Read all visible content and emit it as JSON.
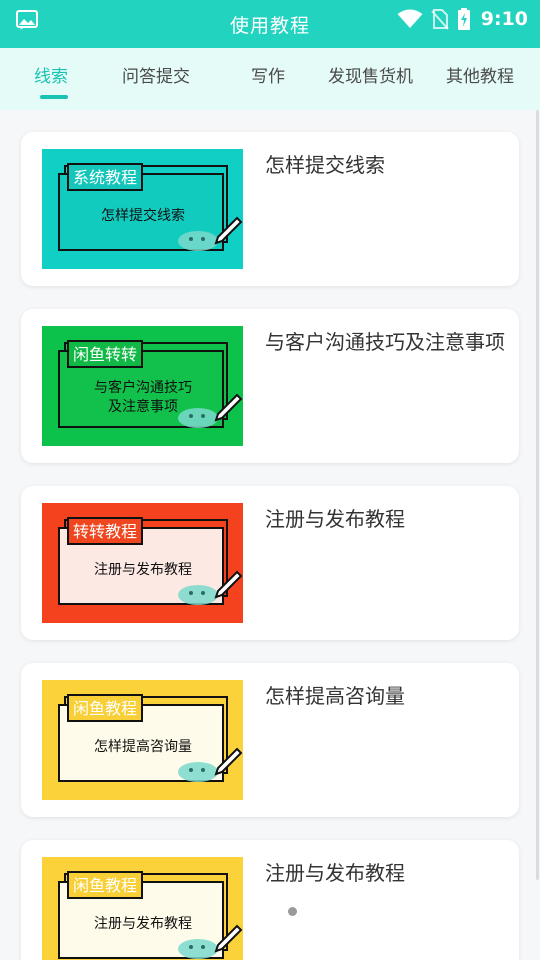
{
  "header": {
    "title": "使用教程",
    "left_icon": "gallery-icon",
    "status_icons": [
      "wifi-icon",
      "no-sim-icon",
      "battery-charging-icon"
    ],
    "time": "9:10",
    "color": "#22d3c0"
  },
  "tabs": [
    {
      "label": "线索",
      "active": true
    },
    {
      "label": "问答提交",
      "active": false
    },
    {
      "label": "写作",
      "active": false
    },
    {
      "label": "发现售货机",
      "active": false
    },
    {
      "label": "其他教程",
      "active": false
    }
  ],
  "accent_color": "#18c3b3",
  "cards": [
    {
      "title": "怎样提交线索",
      "tag": "系统教程",
      "caption": "怎样提交线索",
      "bg": "#10d0c6",
      "panel": "#11cbbf",
      "tag_bg": "#14c6b9",
      "tag_color": "#ffffff"
    },
    {
      "title": "与客户沟通技巧及注意事项",
      "tag": "闲鱼转转",
      "caption": "与客户沟通技巧及注意事项",
      "caption_lines": [
        "与客户沟通技巧",
        "及注意事项"
      ],
      "bg": "#0dc24a",
      "panel": "#12c14c",
      "tag_bg": "#10b845",
      "tag_color": "#ffffff"
    },
    {
      "title": "注册与发布教程",
      "tag": "转转教程",
      "caption": "注册与发布教程",
      "bg": "#f4421f",
      "panel": "#fde9e3",
      "tag_bg": "#f0461f",
      "tag_color": "#ffffff"
    },
    {
      "title": "怎样提高咨询量",
      "tag": "闲鱼教程",
      "caption": "怎样提高咨询量",
      "bg": "#fbd23a",
      "panel": "#fffbea",
      "tag_bg": "#f8cf36",
      "tag_color": "#ffffff"
    },
    {
      "title": "注册与发布教程",
      "tag": "闲鱼教程",
      "caption": "注册与发布教程",
      "bg": "#fbd23a",
      "panel": "#fffbea",
      "tag_bg": "#f8cf36",
      "tag_color": "#ffffff"
    }
  ]
}
